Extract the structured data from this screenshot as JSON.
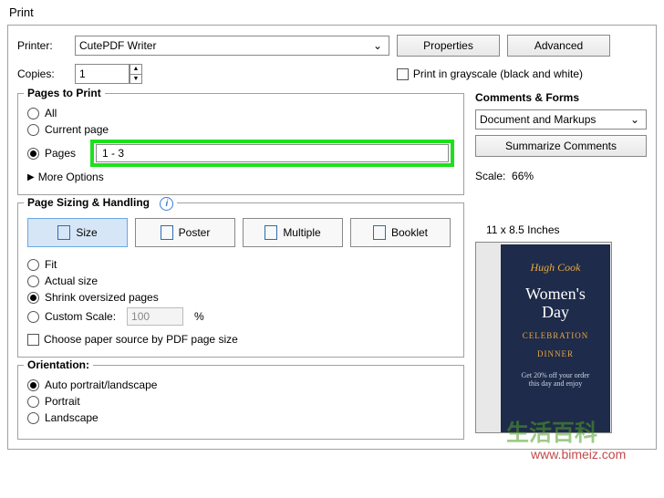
{
  "title": "Print",
  "printer": {
    "label": "Printer:",
    "value": "CutePDF Writer"
  },
  "buttons": {
    "properties": "Properties",
    "advanced": "Advanced",
    "summarize": "Summarize Comments"
  },
  "copies": {
    "label": "Copies:",
    "value": "1"
  },
  "grayscale": {
    "label": "Print in grayscale (black and white)"
  },
  "pagesToPrint": {
    "legend": "Pages to Print",
    "all": "All",
    "current": "Current page",
    "pages": "Pages",
    "pagesValue": "1 - 3",
    "more": "More Options"
  },
  "sizing": {
    "legend": "Page Sizing & Handling",
    "tabs": {
      "size": "Size",
      "poster": "Poster",
      "multiple": "Multiple",
      "booklet": "Booklet"
    },
    "fit": "Fit",
    "actual": "Actual size",
    "shrink": "Shrink oversized pages",
    "custom": "Custom Scale:",
    "customValue": "100",
    "percent": "%",
    "choosePaper": "Choose paper source by PDF page size"
  },
  "orientation": {
    "legend": "Orientation:",
    "auto": "Auto portrait/landscape",
    "portrait": "Portrait",
    "landscape": "Landscape"
  },
  "commentsForms": {
    "legend": "Comments & Forms",
    "value": "Document and Markups"
  },
  "scale": {
    "label": "Scale:",
    "value": "66%"
  },
  "previewSize": "11 x 8.5 Inches",
  "flyer": {
    "logo": "Hugh Cook",
    "title1": "Women's",
    "title2": "Day",
    "sub1": "CELEBRATION",
    "sub2": "DINNER",
    "small1": "Get 20% off your order",
    "small2": "this day and enjoy"
  },
  "watermark": {
    "text": "生活百科",
    "url": "www.bimeiz.com"
  }
}
